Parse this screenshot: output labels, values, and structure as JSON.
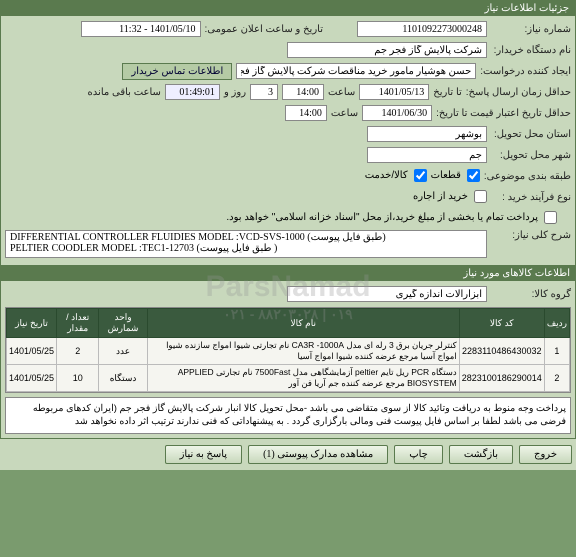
{
  "panels": {
    "info_title": "جزئیات اطلاعات نیاز",
    "items_title": "اطلاعات کالاهای مورد نیاز"
  },
  "fields": {
    "need_no_label": "شماره نیاز:",
    "need_no": "1101092273000248",
    "announce_label": "تاریخ و ساعت اعلان عمومی:",
    "announce_val": "1401/05/10 - 11:32",
    "buyer_label": "نام دستگاه خریدار:",
    "buyer_val": "شرکت پالایش گاز فجر جم",
    "requester_label": "ایجاد کننده درخواست:",
    "requester_val": "حسن هوشیار مامور خرید مناقصات شرکت پالایش گاز فجر جم",
    "contact_btn": "اطلاعات تماس خریدار",
    "deadline_label": "حداقل زمان ارسال پاسخ:",
    "until_label": "تا تاریخ",
    "deadline_date": "1401/05/13",
    "time_label": "ساعت",
    "deadline_time": "14:00",
    "days": "3",
    "days_label": "روز و",
    "remain_time": "01:49:01",
    "remain_label": "ساعت باقی مانده",
    "validity_label": "حداقل تاریخ اعتبار قیمت تا تاریخ:",
    "validity_date": "1401/06/30",
    "validity_time": "14:00",
    "province_label": "استان محل تحویل:",
    "province_val": "بوشهر",
    "city_label": "شهر محل تحویل:",
    "city_val": "جم",
    "category_label": "طبقه بندی موضوعی:",
    "purchase_type_label": "نوع فرآیند خرید :",
    "cat_part": "قطعات",
    "cat_goods": "کالا/خدمت",
    "cat_hire": "خرید از اجاره",
    "pay_note": "پرداخت تمام یا بخشی از مبلغ خرید،از محل \"اسناد خزانه اسلامی\" خواهد بود.",
    "desc_label": "شرح کلی نیاز:",
    "desc_val": "DIFFERENTIAL CONTROLLER FLUIDIES MODEL :VCD-SVS-1000 (طبق فایل پیوست)\nPELTIER COODLER MODEL :TEC1-12703 (طبق فایل پیوست )",
    "group_label": "گروه کالا:",
    "group_val": "ابزارآلات اندازه گیری"
  },
  "table": {
    "headers": [
      "ردیف",
      "کد کالا",
      "نام کالا",
      "واحد شمارش",
      "تعداد / مقدار",
      "تاریخ نیاز"
    ],
    "rows": [
      {
        "idx": "1",
        "code": "2283110486430032",
        "name": "کنترلر جریان برق 3 رله ای مدل CA3R -1000A نام تجارتی شیوا امواج سازنده شیوا امواج آسیا مرجع عرضه کننده شیوا امواج آسیا",
        "unit": "عدد",
        "qty": "2",
        "date": "1401/05/25"
      },
      {
        "idx": "2",
        "code": "2823100186290014",
        "name": "دستگاه PCR ریل تایم peltier آزمایشگاهی مدل 7500Fast نام تجارتی APPLIED BIOSYSTEM مرجع عرضه کننده جم آریا فن آور",
        "unit": "دستگاه",
        "qty": "10",
        "date": "1401/05/25"
      }
    ]
  },
  "note": "پرداخت وجه منوط به دریافت وتائید کالا از سوی متقاضی می باشد -محل تحویل کالا انبار شرکت پالایش گاز فجر جم (ایران کدهای مربوطه فرضی می باشد لطفا بر اساس فایل پیوست فنی ومالی بارگزاری گردد . به پیشنهاداتی که فنی ندارند  ترتیب اثر داده نخواهد شد",
  "buttons": {
    "back": "بازگشت",
    "print": "چاپ",
    "docs": "مشاهده مدارک پیوستی (1)",
    "reply": "پاسخ به نیاز",
    "exit": "خروج"
  },
  "watermark": {
    "main": "ParsNamad",
    "sub": "۰۲۱ - ۸۸۲۰۳۰۲۸ | ۰۱۹"
  }
}
